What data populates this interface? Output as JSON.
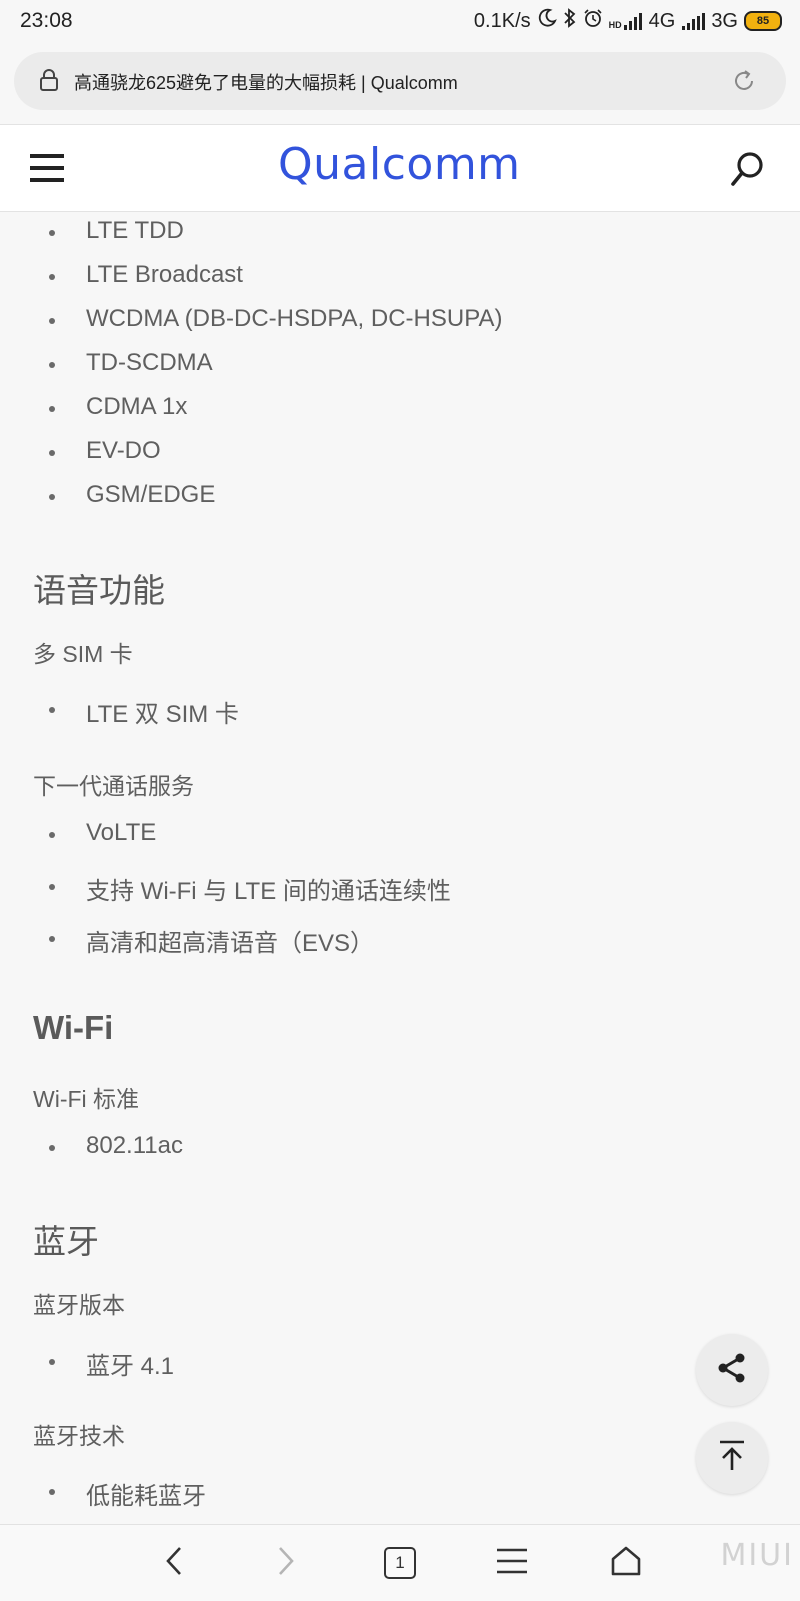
{
  "status_bar": {
    "time": "23:08",
    "net_speed": "0.1K/s",
    "hd": "HD",
    "network_1": "4G",
    "network_2": "3G",
    "battery": "85"
  },
  "address_bar": {
    "title": "高通骁龙625避免了电量的大幅损耗 | Qualcomm"
  },
  "site_header": {
    "logo": "Qualcomm",
    "brand_color": "#3253dc"
  },
  "content": {
    "network_list": [
      "LTE TDD",
      "LTE Broadcast",
      "WCDMA (DB-DC-HSDPA, DC-HSUPA)",
      "TD-SCDMA",
      "CDMA 1x",
      "EV-DO",
      "GSM/EDGE"
    ],
    "voice": {
      "title": "语音功能",
      "multi_sim": {
        "label": "多 SIM 卡",
        "items": [
          "LTE 双 SIM 卡"
        ]
      },
      "next_gen": {
        "label": "下一代通话服务",
        "items": [
          "VoLTE",
          "支持 Wi-Fi 与 LTE 间的通话连续性",
          "高清和超高清语音（EVS）"
        ]
      }
    },
    "wifi": {
      "title": "Wi-Fi",
      "standard": {
        "label": "Wi-Fi 标准",
        "items": [
          "802.11ac"
        ]
      }
    },
    "bluetooth": {
      "title": "蓝牙",
      "version": {
        "label": "蓝牙版本",
        "items": [
          "蓝牙 4.1"
        ]
      },
      "tech": {
        "label": "蓝牙技术",
        "items": [
          "低能耗蓝牙"
        ]
      }
    }
  },
  "bottom_nav": {
    "tab_count": "1"
  },
  "watermark": "MIUI"
}
